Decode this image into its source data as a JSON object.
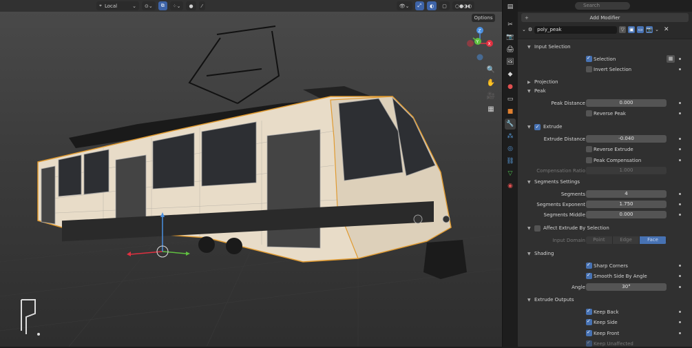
{
  "viewport": {
    "header": {
      "transform_orientation": "Local",
      "options_label": "Options"
    },
    "nav_gizmo": {
      "z_label": "Z",
      "y_label": "Y",
      "x_label": "X"
    }
  },
  "properties": {
    "search_placeholder": "Search",
    "add_modifier_label": "Add Modifier",
    "modifier_name": "poly_peak",
    "sections": {
      "input_selection": "Input Selection",
      "projection": "Projection",
      "peak": "Peak",
      "extrude": "Extrude",
      "segments_settings": "Segments Settings",
      "affect_extrude": "Affect Extrude By Selection",
      "shading": "Shading",
      "extrude_outputs": "Extrude Outputs"
    },
    "selection_label": "Selection",
    "invert_selection_label": "Invert Selection",
    "peak_distance_label": "Peak Distance",
    "peak_distance_value": "0.000",
    "reverse_peak_label": "Reverse Peak",
    "extrude_distance_label": "Extrude Distance",
    "extrude_distance_value": "-0.040",
    "reverse_extrude_label": "Reverse Extrude",
    "peak_compensation_label": "Peak Compensation",
    "compensation_ratio_label": "Compensation Ratio",
    "compensation_ratio_value": "1.000",
    "segments_label": "Segments",
    "segments_value": "4",
    "segments_exponent_label": "Segments Exponent",
    "segments_exponent_value": "1.750",
    "segments_middle_label": "Segments Middle",
    "segments_middle_value": "0.000",
    "input_domain_label": "Input Domain",
    "input_domain_options": [
      "Point",
      "Edge",
      "Face"
    ],
    "sharp_corners_label": "Sharp Corners",
    "smooth_side_label": "Smooth Side By Angle",
    "angle_label": "Angle",
    "angle_value": "30°",
    "keep_back_label": "Keep Back",
    "keep_side_label": "Keep Side",
    "keep_front_label": "Keep Front",
    "keep_unaffected_label": "Keep Unaffected"
  }
}
